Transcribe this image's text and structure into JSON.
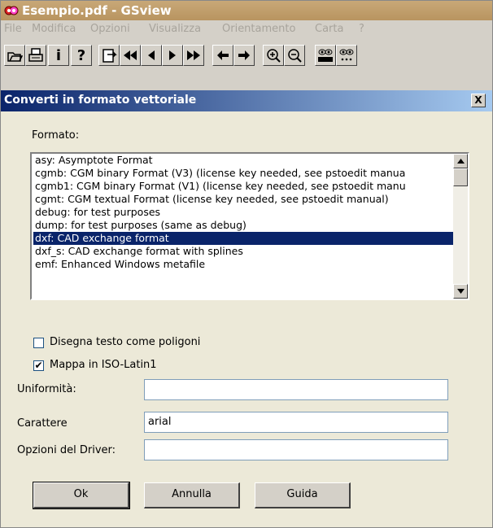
{
  "window": {
    "title": "Esempio.pdf - GSview"
  },
  "menu": [
    "File",
    "Modifica",
    "Opzioni",
    "Visualizza",
    "Orientamento",
    "Carta",
    "?"
  ],
  "toolbar": {
    "icons": [
      "open-icon",
      "print-icon",
      "info-icon",
      "help-icon",
      "goto-page-icon",
      "first-page-icon",
      "prev-page-icon",
      "next-page-icon",
      "last-page-icon",
      "back-icon",
      "forward-icon",
      "zoom-in-icon",
      "zoom-out-icon",
      "text-extract-icon",
      "find-icon"
    ],
    "info_label": "i",
    "help_label": "?"
  },
  "dialog": {
    "title": "Converti in formato vettoriale",
    "close_label": "X",
    "format_label": "Formato:",
    "formats": [
      "asy:  Asymptote Format",
      "cgmb:  CGM binary Format (V3) (license key needed, see pstoedit manua",
      "cgmb1:  CGM binary Format (V1) (license key needed, see pstoedit manu",
      "cgmt:  CGM textual Format (license key needed, see pstoedit manual)",
      "debug:  for test purposes",
      "dump:  for test purposes (same as debug)",
      "dxf:  CAD exchange format",
      "dxf_s:  CAD exchange format with splines",
      "emf:  Enhanced Windows metafile"
    ],
    "selected_index": 6,
    "draw_text_as_polygons": {
      "label": "Disegna testo come poligoni",
      "checked": false
    },
    "map_iso_latin1": {
      "label": "Mappa in ISO-Latin1",
      "checked": true
    },
    "flatness": {
      "label": "Uniformità:",
      "value": ""
    },
    "font": {
      "label": "Carattere",
      "value": "arial"
    },
    "driver_options": {
      "label": "Opzioni del Driver:",
      "value": ""
    },
    "buttons": {
      "ok": "Ok",
      "cancel": "Annulla",
      "help": "Guida"
    }
  }
}
